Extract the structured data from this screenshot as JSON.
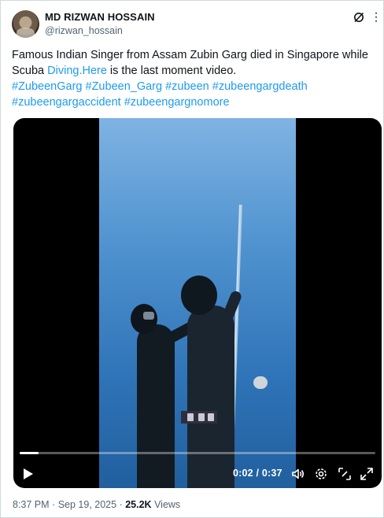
{
  "author": {
    "name": "MD RIZWAN HOSSAIN",
    "handle": "@rizwan_hossain"
  },
  "header_icons": [
    "grok-icon",
    "more-icon"
  ],
  "tweet": {
    "line1": "Famous Indian Singer from Assam Zubin Garg died in Singapore while",
    "line2_prefix": "Scuba ",
    "line2_link": "Diving.Here",
    "line2_suffix": " is the last moment video.",
    "hashtags_line1": [
      "#ZubeenGarg",
      "#Zubeen_Garg",
      "#zubeen",
      "#zubeengargdeath"
    ],
    "hashtags_line2": [
      "#zubeengargaccident",
      "#zubeengargnomore"
    ]
  },
  "video": {
    "time_display": "0:02 / 0:37",
    "progress_fraction": 0.054,
    "controls": [
      "play-icon",
      "volume-icon",
      "settings-icon",
      "fullscreen-exit-icon",
      "expand-icon"
    ]
  },
  "meta": {
    "time": "8:37 PM",
    "separator": "·",
    "date": "Sep 19, 2025",
    "views_count": "25.2K",
    "views_label": "Views"
  },
  "colors": {
    "link": "#1d9bf0",
    "text": "#0f1419",
    "secondary": "#536471"
  }
}
